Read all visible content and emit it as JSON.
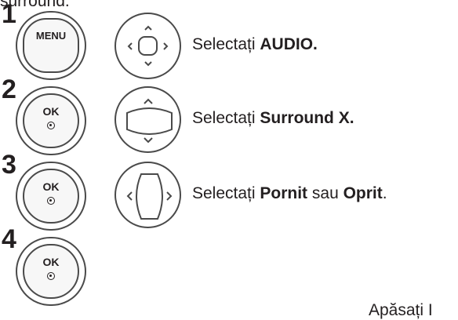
{
  "top_fragment": "surround.",
  "bottom_fragment": "Apăsați I",
  "steps": [
    {
      "number": "1",
      "button_label": "MENU",
      "instruction_prefix": "Selectați ",
      "instruction_bold": "AUDIO.",
      "instruction_mid": "",
      "instruction_bold2": "",
      "instruction_suffix": ""
    },
    {
      "number": "2",
      "button_label": "OK",
      "instruction_prefix": "Selectați ",
      "instruction_bold": "Surround X.",
      "instruction_mid": "",
      "instruction_bold2": "",
      "instruction_suffix": ""
    },
    {
      "number": "3",
      "button_label": "OK",
      "instruction_prefix": "Selectați ",
      "instruction_bold": "Pornit",
      "instruction_mid": " sau ",
      "instruction_bold2": "Oprit",
      "instruction_suffix": "."
    },
    {
      "number": "4",
      "button_label": "OK"
    }
  ],
  "icons": [
    "menu-button-icon",
    "nav-4way-icon",
    "ok-button-icon",
    "nav-updown-icon",
    "nav-leftright-icon"
  ],
  "colors": {
    "text": "#231f20",
    "outline": "#4a4a4a"
  }
}
